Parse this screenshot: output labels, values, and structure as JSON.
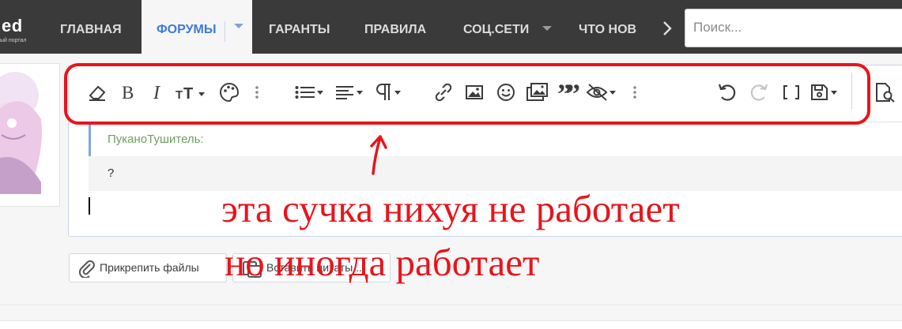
{
  "header": {
    "logo_text": "ed",
    "logo_subtext": "ый портал",
    "nav": [
      {
        "label": "ГЛАВНАЯ"
      },
      {
        "label": "ФОРУМЫ"
      },
      {
        "label": "ГАРАНТЫ"
      },
      {
        "label": "ПРАВИЛА"
      },
      {
        "label": "СОЦ.СЕТИ"
      },
      {
        "label": "ЧТО НОВ"
      }
    ],
    "search_placeholder": "Поиск..."
  },
  "toolbar": {
    "icons": [
      "eraser-icon",
      "bold-icon",
      "italic-icon",
      "font-size-icon",
      "palette-icon",
      "more-vertical-icon",
      "list-icon",
      "align-icon",
      "paragraph-icon",
      "link-icon",
      "image-icon",
      "smiley-icon",
      "media-icon",
      "quote-icon",
      "hide-icon",
      "more-vertical-icon",
      "undo-icon",
      "redo-icon",
      "brackets-icon",
      "save-draft-icon",
      "preview-icon"
    ]
  },
  "editor": {
    "quote_author": "ПуканоТушитель:",
    "quote_text": "?"
  },
  "actions": {
    "attach_label": "Прикрепить файлы",
    "insert_quotes_label": "Вставить цитаты..."
  },
  "annotation": {
    "line1": "эта сучка нихуя не работает",
    "line2": "но иногда работает",
    "color": "#e8141b"
  },
  "colors": {
    "topbar": "#3a3a3a",
    "active_nav": "#3d7bd4",
    "quote_border": "#7fa7de",
    "quote_author": "#6d9f5f"
  }
}
